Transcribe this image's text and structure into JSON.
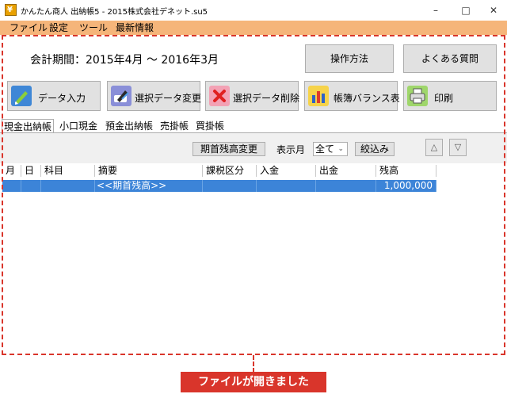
{
  "window": {
    "title": "かんたん商人 出納帳5 - 2015株式会社デネット.su5",
    "icon_glyph": "¥",
    "minimize": "–",
    "maximize": "□",
    "close": "✕"
  },
  "menu": [
    "ファイル",
    "設定",
    "ツール",
    "最新情報"
  ],
  "period": {
    "label": "会計期間：2015年4月 〜 2016年3月"
  },
  "top_buttons": {
    "how_to": "操作方法",
    "faq": "よくある質問"
  },
  "toolbar": [
    {
      "label": "データ入力",
      "icon": "pencil-icon"
    },
    {
      "label": "選択データ変更",
      "icon": "edit-data-icon"
    },
    {
      "label": "選択データ削除",
      "icon": "delete-x-icon"
    },
    {
      "label": "帳簿バランス表",
      "icon": "bar-chart-icon"
    },
    {
      "label": "印刷",
      "icon": "printer-icon"
    }
  ],
  "tabs": [
    "現金出納帳",
    "小口現金",
    "預金出納帳",
    "売掛帳",
    "買掛帳"
  ],
  "filter": {
    "opening_balance_button": "期首残高変更",
    "display_month_label": "表示月",
    "month_value": "全て",
    "narrow_button": "絞込み",
    "up": "△",
    "down": "▽"
  },
  "grid": {
    "headers": [
      "月",
      "日",
      "科目",
      "摘要",
      "課税区分",
      "入金",
      "出金",
      "残高"
    ],
    "rows": [
      {
        "month": "",
        "day": "",
        "account": "",
        "description": "<<期首残高>>",
        "tax": "",
        "deposit": "",
        "withdrawal": "",
        "balance": "1,000,000"
      }
    ]
  },
  "caption": "ファイルが開きました",
  "colors": {
    "menubar": "#f5b57a",
    "highlight": "#d9352b",
    "selected_row": "#3c84d8"
  }
}
